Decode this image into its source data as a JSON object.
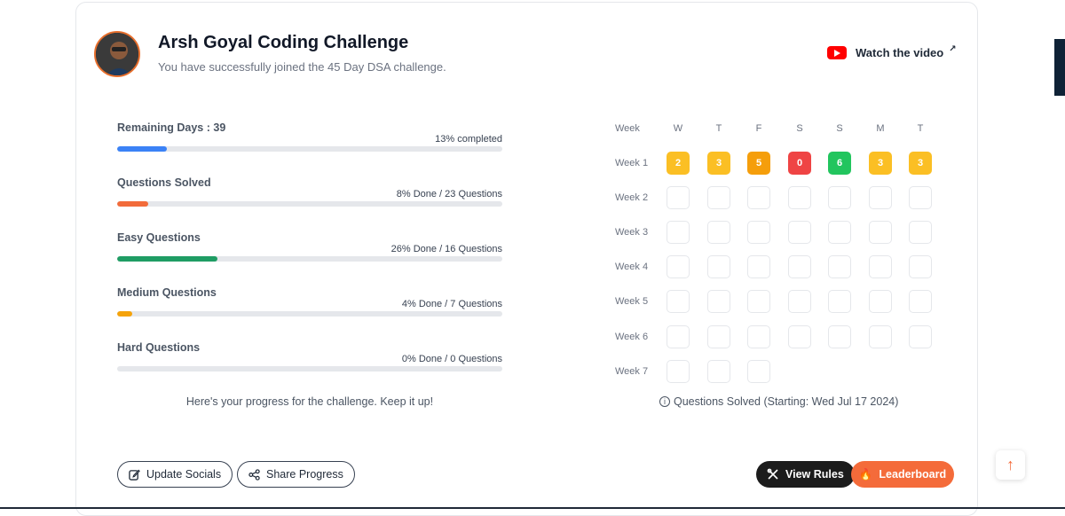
{
  "header": {
    "title": "Arsh Goyal Coding Challenge",
    "subtitle": "You have successfully joined the 45 Day DSA challenge.",
    "watch_label": "Watch the video"
  },
  "progress": [
    {
      "label": "Remaining Days : 39",
      "status": "13% completed",
      "fraction": 0.13,
      "color": "#3b82f6"
    },
    {
      "label": "Questions Solved",
      "status": "8% Done / 23 Questions",
      "fraction": 0.08,
      "color": "#f26b3a"
    },
    {
      "label": "Easy Questions",
      "status": "26% Done / 16 Questions",
      "fraction": 0.26,
      "color": "#1f9d64"
    },
    {
      "label": "Medium Questions",
      "status": "4% Done / 7 Questions",
      "fraction": 0.04,
      "color": "#f5a30a"
    },
    {
      "label": "Hard Questions",
      "status": "0% Done / 0 Questions",
      "fraction": 0.0,
      "color": "#ef4444"
    }
  ],
  "progress_message": "Here's your progress for the challenge. Keep it up!",
  "calendar": {
    "week_header": "Week",
    "days": [
      "W",
      "T",
      "F",
      "S",
      "S",
      "M",
      "T"
    ],
    "weeks": [
      "Week 1",
      "Week 2",
      "Week 3",
      "Week 4",
      "Week 5",
      "Week 6",
      "Week 7"
    ],
    "week1_values": [
      "2",
      "3",
      "5",
      "0",
      "6",
      "3",
      "3"
    ],
    "week1_colors": [
      "#fbbf24",
      "#fbbf24",
      "#f59e0b",
      "#ef4444",
      "#22c55e",
      "#fbbf24",
      "#fbbf24"
    ],
    "note": "Questions Solved (Starting: Wed Jul 17 2024)"
  },
  "buttons": {
    "update_socials": "Update Socials",
    "share_progress": "Share Progress",
    "view_rules": "View Rules",
    "leaderboard": "Leaderboard"
  },
  "colors": {
    "accent": "#f46b3a",
    "dark": "#1c1c1c"
  }
}
